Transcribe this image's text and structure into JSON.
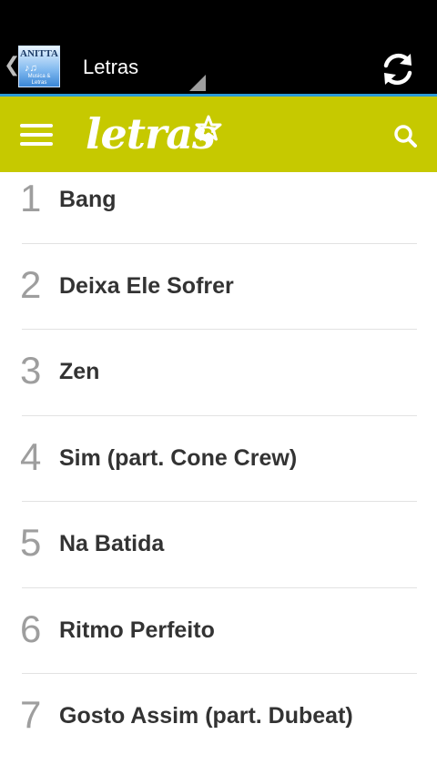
{
  "action_bar": {
    "title": "Letras",
    "app_icon": {
      "name": "app-icon",
      "text_top": "ANITTA",
      "text_line1": "Musica &",
      "text_line2": "Letras"
    },
    "refresh_icon": "refresh-icon"
  },
  "brand_bar": {
    "logo_text": "letras",
    "menu_icon": "hamburger-menu-icon",
    "search_icon": "search-icon",
    "background_color": "#c6c900"
  },
  "songs": [
    {
      "num": "1",
      "title": "Bang"
    },
    {
      "num": "2",
      "title": "Deixa Ele Sofrer"
    },
    {
      "num": "3",
      "title": "Zen"
    },
    {
      "num": "4",
      "title": "Sim (part. Cone Crew)"
    },
    {
      "num": "5",
      "title": "Na Batida"
    },
    {
      "num": "6",
      "title": "Ritmo Perfeito"
    },
    {
      "num": "7",
      "title": "Gosto Assim (part. Dubeat)"
    }
  ]
}
